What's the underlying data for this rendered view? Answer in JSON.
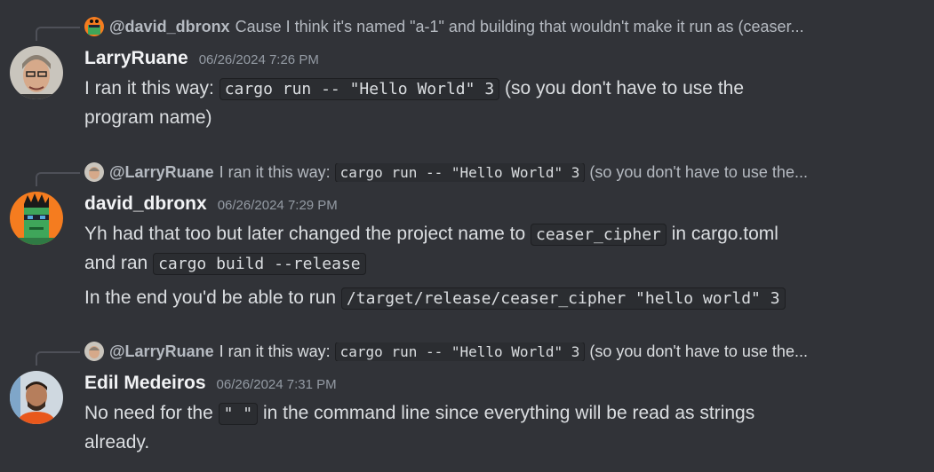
{
  "messages": [
    {
      "reply": {
        "author": "@david_dbronx",
        "text": "Cause I think it's named \"a-1\" and building that wouldn't make it run as (ceaser..."
      },
      "author": "LarryRuane",
      "timestamp": "06/26/2024 7:26 PM",
      "content": {
        "pre": "I ran it this way: ",
        "code": "cargo run -- \"Hello World\" 3",
        "post": " (so you don't have to use the",
        "line2": "program name)"
      }
    },
    {
      "reply": {
        "author": "@LarryRuane",
        "pre": "I ran it this way: ",
        "code": "cargo run -- \"Hello World\" 3",
        "post": " (so you don't have to use the..."
      },
      "author": "david_dbronx",
      "timestamp": "06/26/2024 7:29 PM",
      "content": {
        "pre": "Yh had that too but later changed the project name to ",
        "code1": "ceaser_cipher",
        "mid": " in cargo.toml",
        "line2_pre": "and ran ",
        "code2": "cargo build --release",
        "para2_pre": "In the end you'd be able to run ",
        "code3": "/target/release/ceaser_cipher \"hello world\" 3"
      }
    },
    {
      "reply": {
        "author": "@LarryRuane",
        "pre": "I ran it this way: ",
        "code": "cargo run -- \"Hello World\" 3",
        "post": " (so you don't have to use the..."
      },
      "author": "Edil Medeiros",
      "timestamp": "06/26/2024 7:31 PM",
      "content": {
        "pre": "No need for the ",
        "code": "\" \"",
        "post": " in the command line since everything will be read as strings",
        "line2": "already."
      }
    }
  ]
}
